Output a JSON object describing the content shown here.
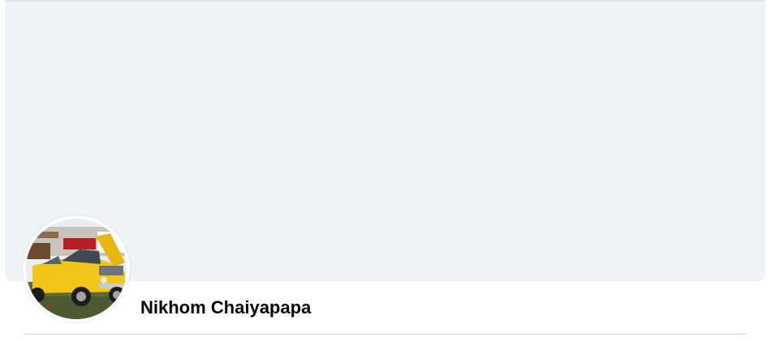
{
  "cover": {
    "background_color": "#f0f2f5"
  },
  "profile": {
    "name": "Nikhom Chaiyapapa",
    "avatar_icon": "profile-photo-yellow-car"
  },
  "colors": {
    "page_background": "#ffffff",
    "name_text": "#050505",
    "divider": "#ced0d4",
    "avatar_car": "#f2c618"
  }
}
